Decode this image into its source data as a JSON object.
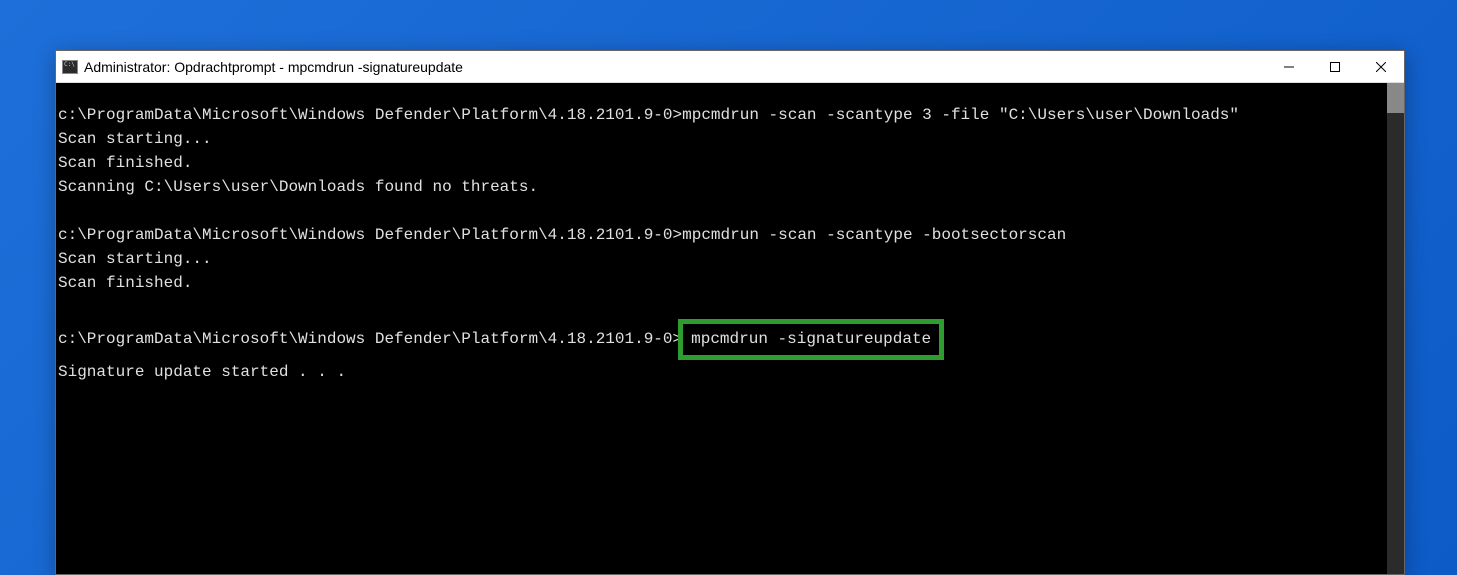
{
  "window": {
    "title": "Administrator: Opdrachtprompt - mpcmdrun  -signatureupdate"
  },
  "console": {
    "prompt1": "c:\\ProgramData\\Microsoft\\Windows Defender\\Platform\\4.18.2101.9-0>",
    "cmd1": "mpcmdrun -scan -scantype 3 -file \"C:\\Users\\user\\Downloads\"",
    "out1a": "Scan starting...",
    "out1b": "Scan finished.",
    "out1c": "Scanning C:\\Users\\user\\Downloads found no threats.",
    "prompt2": "c:\\ProgramData\\Microsoft\\Windows Defender\\Platform\\4.18.2101.9-0>",
    "cmd2": "mpcmdrun -scan -scantype -bootsectorscan",
    "out2a": "Scan starting...",
    "out2b": "Scan finished.",
    "prompt3": "c:\\ProgramData\\Microsoft\\Windows Defender\\Platform\\4.18.2101.9-0>",
    "cmd3": "mpcmdrun -signatureupdate",
    "out3a": "Signature update started . . ."
  }
}
